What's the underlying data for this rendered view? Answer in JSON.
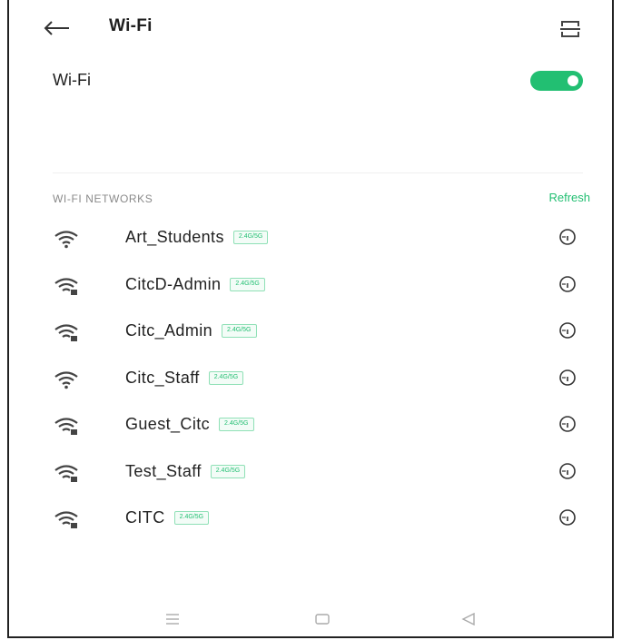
{
  "app": {
    "title": "Wi-Fi",
    "icons": {
      "back": "back-arrow-icon",
      "scan": "qr-scan-icon"
    }
  },
  "wifi_toggle": {
    "label": "Wi-Fi",
    "enabled": true,
    "color_on": "#22bf72"
  },
  "networks_section": {
    "title": "WI-FI NETWORKS",
    "refresh_label": "Refresh"
  },
  "networks": [
    {
      "name": "Art_Students",
      "band": "2.4G/5G",
      "secured": false
    },
    {
      "name": "CitcD-Admin",
      "band": "2.4G/5G",
      "secured": true
    },
    {
      "name": "Citc_Admin",
      "band": "2.4G/5G",
      "secured": true
    },
    {
      "name": "Citc_Staff",
      "band": "2.4G/5G",
      "secured": false
    },
    {
      "name": "Guest_Citc",
      "band": "2.4G/5G",
      "secured": true
    },
    {
      "name": "Test_Staff",
      "band": "2.4G/5G",
      "secured": true
    },
    {
      "name": "CITC",
      "band": "2.4G/5G",
      "secured": true
    }
  ],
  "nav_bar": {
    "items": [
      "menu-icon",
      "home-icon",
      "back-triangle-icon"
    ]
  },
  "colors": {
    "accent": "#22bf72",
    "text": "#222222",
    "muted": "#8a8a8a"
  }
}
